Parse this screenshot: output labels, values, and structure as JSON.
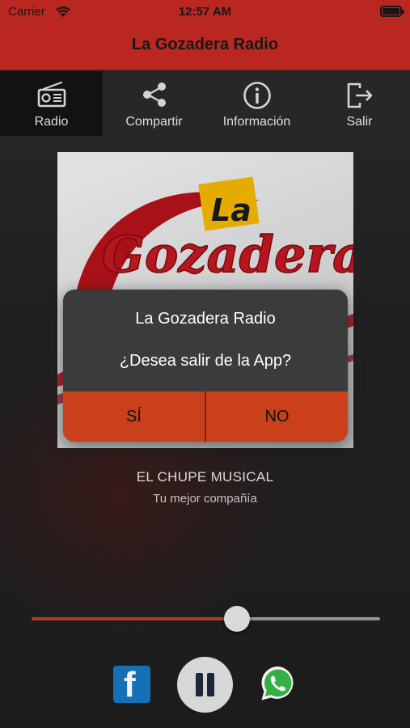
{
  "status_bar": {
    "carrier": "Carrier",
    "time": "12:57 AM"
  },
  "header": {
    "title": "La Gozadera Radio",
    "color": "#c32a22"
  },
  "tabs": [
    {
      "label": "Radio",
      "icon": "radio-icon",
      "active": true
    },
    {
      "label": "Compartir",
      "icon": "share-icon",
      "active": false
    },
    {
      "label": "Información",
      "icon": "info-icon",
      "active": false
    },
    {
      "label": "Salir",
      "icon": "exit-icon",
      "active": false
    }
  ],
  "artwork": {
    "logo_text_small": "La",
    "logo_text_large": "Gozadera"
  },
  "station": {
    "name": "EL CHUPE MUSICAL",
    "slogan": "Tu mejor compañía"
  },
  "volume": {
    "level": 0.59
  },
  "controls": {
    "facebook_icon": "facebook-icon",
    "play_pause_icon": "pause-icon",
    "whatsapp_icon": "whatsapp-icon"
  },
  "dialog": {
    "title": "La Gozadera Radio",
    "message": "¿Desea salir de la App?",
    "yes_label": "SÍ",
    "no_label": "NO",
    "button_color": "#c9401a"
  }
}
